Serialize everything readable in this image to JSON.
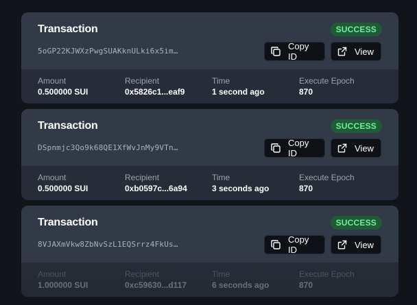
{
  "transactions": [
    {
      "title": "Transaction",
      "status": "SUCCESS",
      "hash": "5oGP22KJWXzPwgSUAKknULki6x5im…",
      "copy_label": "Copy ID",
      "view_label": "View",
      "fields": {
        "amount_label": "Amount",
        "amount": "0.500000 SUI",
        "recipient_label": "Recipient",
        "recipient": "0x5826c1...eaf9",
        "time_label": "Time",
        "time": "1 second ago",
        "epoch_label": "Execute Epoch",
        "epoch": "870"
      }
    },
    {
      "title": "Transaction",
      "status": "SUCCESS",
      "hash": "DSpnmjc3Qo9k68QE1XfWvJnMy9VTn…",
      "copy_label": "Copy ID",
      "view_label": "View",
      "fields": {
        "amount_label": "Amount",
        "amount": "0.500000 SUI",
        "recipient_label": "Recipient",
        "recipient": "0xb0597c...6a94",
        "time_label": "Time",
        "time": "3 seconds ago",
        "epoch_label": "Execute Epoch",
        "epoch": "870"
      }
    },
    {
      "title": "Transaction",
      "status": "SUCCESS",
      "hash": "8VJAXmVkw8ZbNvSzL1EQSrrz4FkUs…",
      "copy_label": "Copy ID",
      "view_label": "View",
      "fields": {
        "amount_label": "Amount",
        "amount": "1.000000 SUI",
        "recipient_label": "Recipient",
        "recipient": "0xc59630...d117",
        "time_label": "Time",
        "time": "6 seconds ago",
        "epoch_label": "Execute Epoch",
        "epoch": "870"
      }
    }
  ],
  "colors": {
    "background": "#111419",
    "card": "#323a47",
    "badge_bg": "#1f5c36",
    "badge_text": "#6ff09b"
  },
  "icons": {
    "copy": "copy-icon",
    "view": "external-link-icon"
  }
}
